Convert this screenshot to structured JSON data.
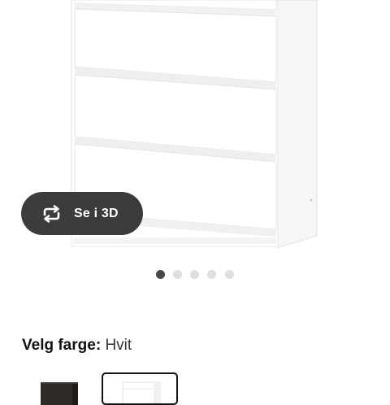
{
  "product": {
    "view_3d_label": "Se i 3D",
    "view_3d_icon": "rotate-3d-icon",
    "image_count": 5,
    "active_image_index": 0
  },
  "color_selector": {
    "label": "Velg farge:",
    "selected_value": "Hvit",
    "options": [
      {
        "name": "black-brown",
        "color": "#2e2a27",
        "selected": false
      },
      {
        "name": "white",
        "color": "#ffffff",
        "selected": true
      }
    ]
  },
  "colors": {
    "button_bg": "#3b3b3b",
    "dot_active": "#484848",
    "dot_inactive": "#dfdfdf",
    "furniture_white": "#ffffff",
    "furniture_shadow": "#ebebeb"
  }
}
